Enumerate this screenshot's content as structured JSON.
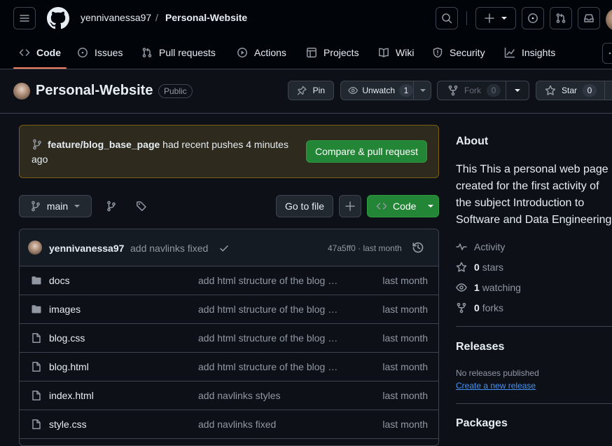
{
  "header": {
    "owner": "yennivanessa97",
    "separator": "/",
    "repo": "Personal-Website"
  },
  "nav": {
    "tabs": [
      {
        "label": "Code"
      },
      {
        "label": "Issues"
      },
      {
        "label": "Pull requests"
      },
      {
        "label": "Actions"
      },
      {
        "label": "Projects"
      },
      {
        "label": "Wiki"
      },
      {
        "label": "Security"
      },
      {
        "label": "Insights"
      }
    ]
  },
  "repo": {
    "name": "Personal-Website",
    "visibility": "Public",
    "pin_label": "Pin",
    "unwatch_label": "Unwatch",
    "watch_count": "1",
    "fork_label": "Fork",
    "fork_count": "0",
    "star_label": "Star",
    "star_count": "0"
  },
  "banner": {
    "branch": "feature/blog_base_page",
    "text": " had recent pushes 4 minutes ago",
    "button": "Compare & pull request"
  },
  "toolbar": {
    "branch": "main",
    "go_to_file": "Go to file",
    "code_label": "Code"
  },
  "commit": {
    "author": "yennivanessa97",
    "message": "add navlinks fixed",
    "meta": "47a5ff0 · last month"
  },
  "files": [
    {
      "name": "docs",
      "type": "folder",
      "message": "add html structure of the blog page",
      "age": "last month"
    },
    {
      "name": "images",
      "type": "folder",
      "message": "add html structure of the blog page",
      "age": "last month"
    },
    {
      "name": "blog.css",
      "type": "file",
      "message": "add html structure of the blog page",
      "age": "last month"
    },
    {
      "name": "blog.html",
      "type": "file",
      "message": "add html structure of the blog page",
      "age": "last month"
    },
    {
      "name": "index.html",
      "type": "file",
      "message": "add navlinks styles",
      "age": "last month"
    },
    {
      "name": "style.css",
      "type": "file",
      "message": "add navlinks fixed",
      "age": "last month"
    }
  ],
  "about": {
    "heading": "About",
    "description": "This This a personal web page created for the first activity of the subject Introduction to Software and Data Engineering",
    "activity": "Activity",
    "stars_count": "0",
    "stars_label": "stars",
    "watching_count": "1",
    "watching_label": "watching",
    "forks_count": "0",
    "forks_label": "forks"
  },
  "releases": {
    "heading": "Releases",
    "empty": "No releases published",
    "create_link": "Create a new release"
  },
  "packages": {
    "heading": "Packages"
  },
  "colors": {
    "accent_green": "#238636",
    "tab_underline": "#f78166",
    "link": "#4493f8",
    "banner_bg": "#2e2a1d"
  }
}
